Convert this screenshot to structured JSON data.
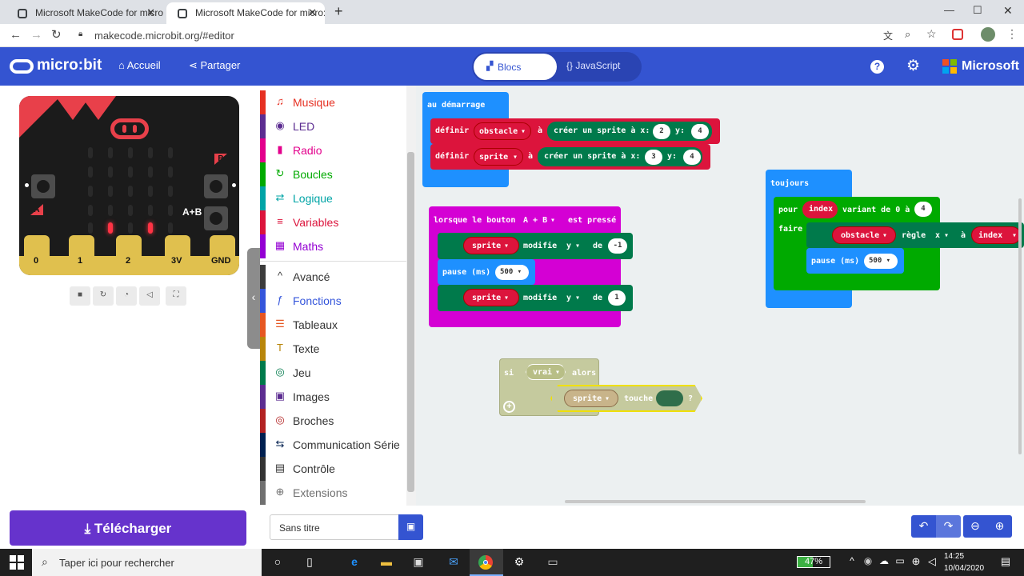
{
  "browser": {
    "tabs": [
      {
        "title": "Microsoft MakeCode for micro:bi"
      },
      {
        "title": "Microsoft MakeCode for micro:bi"
      }
    ],
    "url": "makecode.microbit.org/#editor"
  },
  "header": {
    "logo": "micro:bit",
    "home": "Accueil",
    "share": "Partager",
    "blocks_tab": "Blocs",
    "js_tab": "JavaScript",
    "brand": "Microsoft"
  },
  "simulator": {
    "button_a": "A",
    "button_b": "B",
    "button_ab": "A+B",
    "pins": [
      "0",
      "1",
      "2",
      "3V",
      "GND"
    ]
  },
  "toolbox": [
    {
      "label": "Musique",
      "color": "#e63022",
      "icon": "headphones-icon",
      "glyph": "♫"
    },
    {
      "label": "LED",
      "color": "#5c2d91",
      "icon": "toggle-icon",
      "glyph": "◉"
    },
    {
      "label": "Radio",
      "color": "#e3008c",
      "icon": "signal-icon",
      "glyph": "▮"
    },
    {
      "label": "Boucles",
      "color": "#00aa00",
      "icon": "loop-icon",
      "glyph": "↻"
    },
    {
      "label": "Logique",
      "color": "#00a4a6",
      "icon": "shuffle-icon",
      "glyph": "⇄"
    },
    {
      "label": "Variables",
      "color": "#dc143c",
      "icon": "lines-icon",
      "glyph": "≡"
    },
    {
      "label": "Maths",
      "color": "#9400d3",
      "icon": "calculator-icon",
      "glyph": "▦"
    },
    {
      "label": "Avancé",
      "color": "#3c3c3c",
      "icon": "chevron-up-icon",
      "glyph": "^"
    },
    {
      "label": "Fonctions",
      "color": "#3455db",
      "icon": "function-icon",
      "glyph": "ƒ"
    },
    {
      "label": "Tableaux",
      "color": "#e65722",
      "icon": "list-icon",
      "glyph": "☰"
    },
    {
      "label": "Texte",
      "color": "#b8860b",
      "icon": "text-icon",
      "glyph": "T"
    },
    {
      "label": "Jeu",
      "color": "#007a4b",
      "icon": "gamepad-icon",
      "glyph": "◎"
    },
    {
      "label": "Images",
      "color": "#5c2d91",
      "icon": "image-icon",
      "glyph": "▣"
    },
    {
      "label": "Broches",
      "color": "#b22222",
      "icon": "target-icon",
      "glyph": "◎"
    },
    {
      "label": "Communication Série",
      "color": "#002050",
      "icon": "usb-icon",
      "glyph": "⇆"
    },
    {
      "label": "Contrôle",
      "color": "#333333",
      "icon": "server-icon",
      "glyph": "▤"
    },
    {
      "label": "Extensions",
      "color": "#707070",
      "icon": "plus-circle-icon",
      "glyph": "⊕"
    }
  ],
  "blocks": {
    "on_start": {
      "title": "au démarrage",
      "line1": {
        "set": "définir",
        "var": "obstacle",
        "to": "à",
        "create": "créer un sprite à x:",
        "x": "2",
        "ylabel": "y:",
        "y": "4"
      },
      "line2": {
        "set": "définir",
        "var": "sprite",
        "to": "à",
        "create": "créer un sprite à x:",
        "x": "3",
        "ylabel": "y:",
        "y": "4"
      }
    },
    "on_button": {
      "title": "lorsque le bouton",
      "button": "A + B",
      "pressed": "est pressé",
      "move1": {
        "var": "sprite",
        "action": "modifie",
        "axis": "y",
        "by": "de",
        "value": "-1"
      },
      "pause": {
        "label": "pause (ms)",
        "value": "500"
      },
      "move2": {
        "var": "sprite",
        "action": "modifie",
        "axis": "y",
        "by": "de",
        "value": "1"
      }
    },
    "forever": {
      "title": "toujours",
      "for": "pour",
      "index": "index",
      "range": "variant de 0 à",
      "to": "4",
      "do": "faire",
      "var": "obstacle",
      "action": "règle",
      "axis": "x",
      "at": "à",
      "index2": "index",
      "pause": "pause (ms)",
      "pause_value": "500"
    },
    "if_block": {
      "if": "si",
      "cond": "vrai",
      "then": "alors",
      "sprite": "sprite",
      "touches": "touche",
      "q": "?"
    }
  },
  "footer": {
    "download": "Télécharger",
    "project_name": "Sans titre"
  },
  "taskbar": {
    "search": "Taper ici pour rechercher",
    "battery": "47%",
    "time": "14:25",
    "date": "10/04/2020"
  }
}
